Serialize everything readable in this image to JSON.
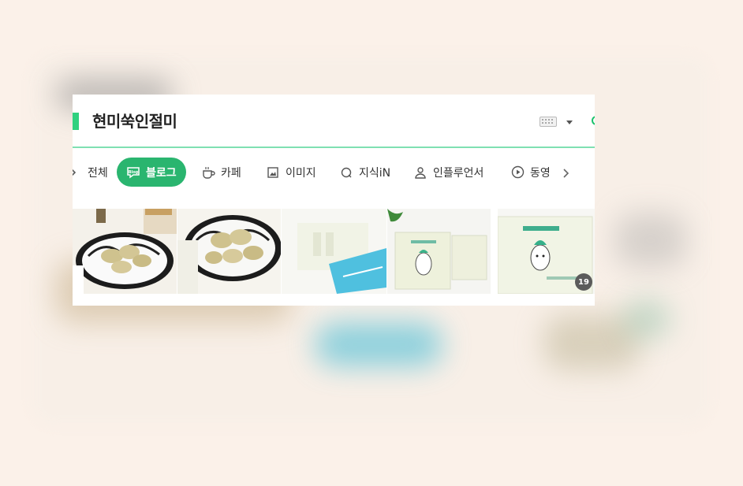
{
  "search": {
    "query": "현미쑥인절미"
  },
  "tabs": [
    {
      "label": "전체",
      "icon": "all-icon"
    },
    {
      "label": "블로그",
      "icon": "blog-icon",
      "active": true
    },
    {
      "label": "카페",
      "icon": "cafe-icon"
    },
    {
      "label": "이미지",
      "icon": "image-icon"
    },
    {
      "label": "지식iN",
      "icon": "knowledge-icon"
    },
    {
      "label": "인플루언서",
      "icon": "influencer-icon"
    },
    {
      "label": "동영",
      "icon": "video-icon"
    }
  ],
  "blog_badge": "Blog",
  "thumbnails": {
    "count_badge": "19",
    "items": [
      {
        "icon": "rice-cake-plate-image"
      },
      {
        "icon": "rice-cake-plate-image"
      },
      {
        "icon": "package-image"
      },
      {
        "icon": "product-box-image"
      },
      {
        "icon": "product-box-image"
      }
    ]
  },
  "colors": {
    "accent": "#2fd17f",
    "active_tab": "#2ab56f",
    "underline": "#7fe0b2"
  }
}
